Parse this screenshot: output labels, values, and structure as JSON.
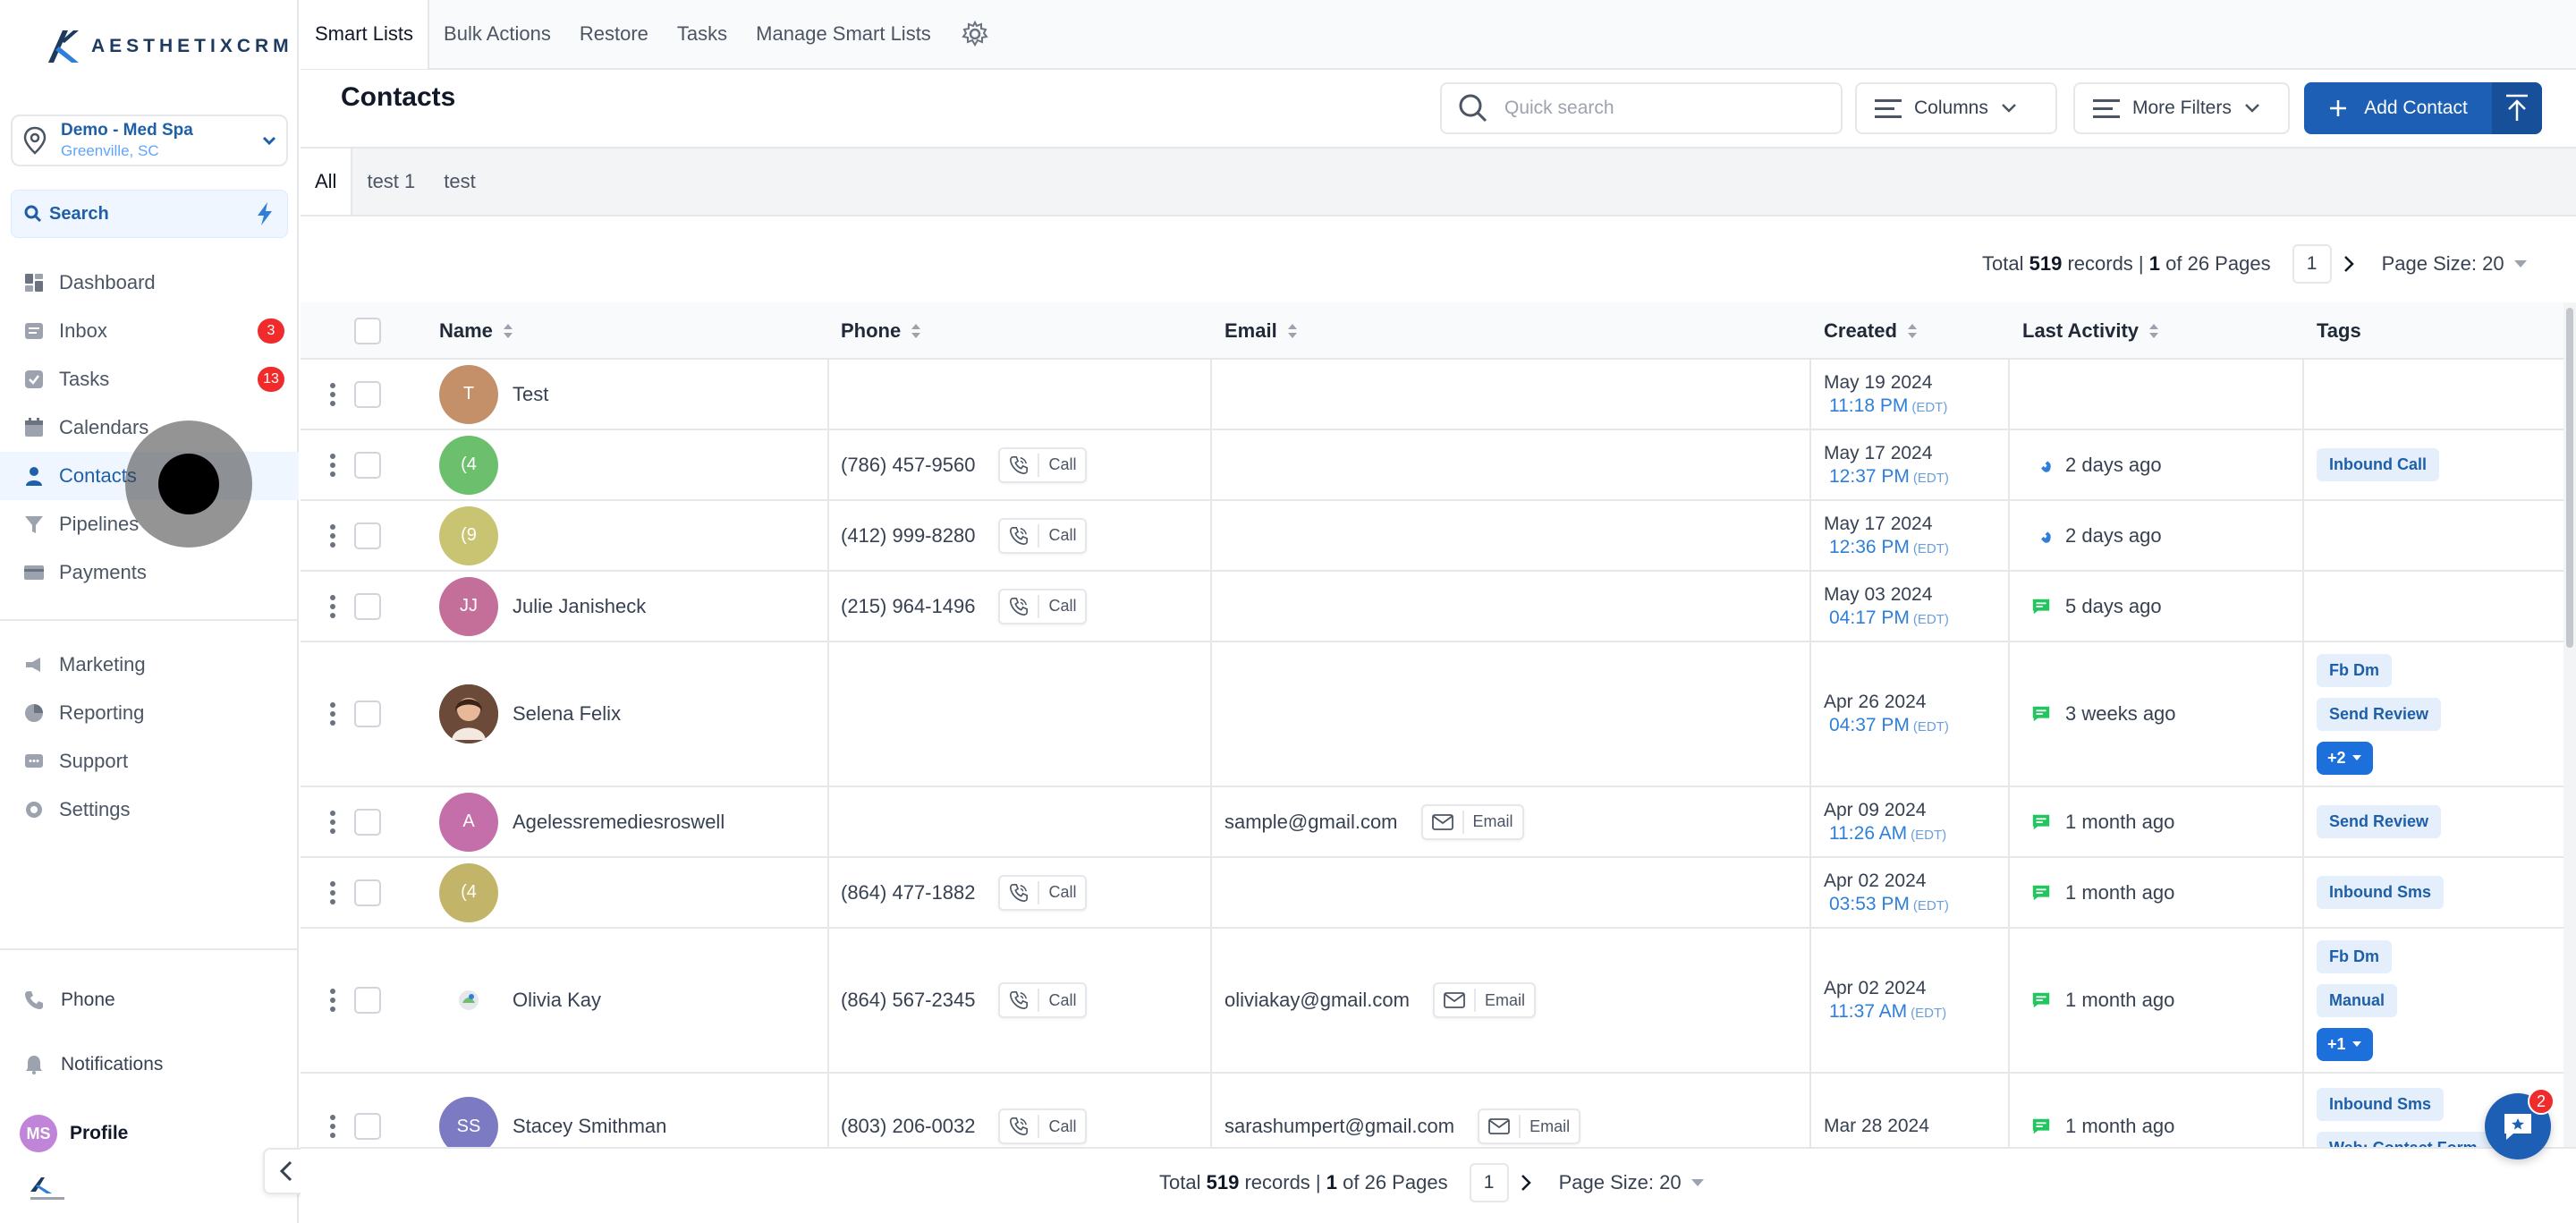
{
  "brand": {
    "logo_text": "AESTHETIXCRM"
  },
  "location": {
    "name": "Demo - Med Spa",
    "city": "Greenville, SC"
  },
  "sidebar": {
    "search_label": "Search",
    "items": [
      {
        "label": "Dashboard",
        "icon": "dashboard-icon"
      },
      {
        "label": "Inbox",
        "icon": "inbox-icon",
        "badge": "3"
      },
      {
        "label": "Tasks",
        "icon": "tasks-icon",
        "badge": "13"
      },
      {
        "label": "Calendars",
        "icon": "calendar-icon"
      },
      {
        "label": "Contacts",
        "icon": "user-icon",
        "active": true
      },
      {
        "label": "Pipelines",
        "icon": "filter-icon"
      },
      {
        "label": "Payments",
        "icon": "card-icon"
      }
    ],
    "items2": [
      {
        "label": "Marketing",
        "icon": "megaphone-icon"
      },
      {
        "label": "Reporting",
        "icon": "pie-chart-icon"
      },
      {
        "label": "Support",
        "icon": "chat-icon"
      },
      {
        "label": "Settings",
        "icon": "gear-icon"
      }
    ],
    "bottom": {
      "phone": "Phone",
      "notifications": "Notifications",
      "profile": "Profile",
      "profile_initials": "MS"
    }
  },
  "top_tabs": [
    "Smart Lists",
    "Bulk Actions",
    "Restore",
    "Tasks",
    "Manage Smart Lists"
  ],
  "header": {
    "title": "Contacts",
    "search_placeholder": "Quick search",
    "columns_label": "Columns",
    "filters_label": "More Filters",
    "add_label": "Add Contact"
  },
  "list_tabs": [
    "All",
    "test 1",
    "test"
  ],
  "pagination": {
    "total_prefix": "Total",
    "total": "519",
    "records_label": "records |",
    "page": "1",
    "of_label": "of 26 Pages",
    "current_page": "1",
    "page_size": "Page Size: 20"
  },
  "table": {
    "columns": [
      "Name",
      "Phone",
      "Email",
      "Created",
      "Last Activity",
      "Tags"
    ],
    "call_label": "Call",
    "email_label": "Email",
    "rows": [
      {
        "initials": "T",
        "avatar_color": "#c4906a",
        "name": "Test",
        "phone": "",
        "email": "",
        "date": "May 19 2024",
        "time": "11:18 PM",
        "tz": "(EDT)",
        "activity": "",
        "activity_icon": "",
        "tags": []
      },
      {
        "initials": "(4",
        "avatar_color": "#6cbf6c",
        "name": "",
        "phone": "(786) 457-9560",
        "email": "",
        "date": "May 17 2024",
        "time": "12:37 PM",
        "tz": "(EDT)",
        "activity": "2 days ago",
        "activity_icon": "phone-icon",
        "tags": [
          "Inbound Call"
        ]
      },
      {
        "initials": "(9",
        "avatar_color": "#c9c471",
        "name": "",
        "phone": "(412) 999-8280",
        "email": "",
        "date": "May 17 2024",
        "time": "12:36 PM",
        "tz": "(EDT)",
        "activity": "2 days ago",
        "activity_icon": "phone-icon",
        "tags": []
      },
      {
        "initials": "JJ",
        "avatar_color": "#c46f9a",
        "name": "Julie Janisheck",
        "phone": "(215) 964-1496",
        "email": "",
        "date": "May 03 2024",
        "time": "04:17 PM",
        "tz": "(EDT)",
        "activity": "5 days ago",
        "activity_icon": "message-icon",
        "tags": []
      },
      {
        "initials": "",
        "avatar_color": "#6b4a3a",
        "photo": true,
        "name": "Selena Felix",
        "phone": "",
        "email": "",
        "date": "Apr 26 2024",
        "time": "04:37 PM",
        "tz": "(EDT)",
        "activity": "3 weeks ago",
        "activity_icon": "message-icon",
        "tags": [
          "Fb Dm",
          "Send Review"
        ],
        "more": "+2"
      },
      {
        "initials": "A",
        "avatar_color": "#c46fa9",
        "name": "Agelessremediesroswell",
        "phone": "",
        "email": "sample@gmail.com",
        "date": "Apr 09 2024",
        "time": "11:26 AM",
        "tz": "(EDT)",
        "activity": "1 month ago",
        "activity_icon": "message-icon",
        "tags": [
          "Send Review"
        ]
      },
      {
        "initials": "(4",
        "avatar_color": "#c2b56a",
        "name": "",
        "phone": "(864) 477-1882",
        "email": "",
        "date": "Apr 02 2024",
        "time": "03:53 PM",
        "tz": "(EDT)",
        "activity": "1 month ago",
        "activity_icon": "message-icon",
        "tags": [
          "Inbound Sms"
        ]
      },
      {
        "initials": "",
        "avatar_color": "#ffffff",
        "small_logo": true,
        "name": "Olivia Kay",
        "phone": "(864) 567-2345",
        "email": "oliviakay@gmail.com",
        "date": "Apr 02 2024",
        "time": "11:37 AM",
        "tz": "(EDT)",
        "activity": "1 month ago",
        "activity_icon": "message-icon",
        "tags": [
          "Fb Dm",
          "Manual"
        ],
        "more": "+1"
      },
      {
        "initials": "SS",
        "avatar_color": "#7d7ac4",
        "name": "Stacey Smithman",
        "phone": "(803) 206-0032",
        "email": "sarashumpert@gmail.com",
        "date": "Mar 28 2024",
        "time": "",
        "tz": "",
        "activity": "1 month ago",
        "activity_icon": "message-icon",
        "tags": [
          "Inbound Sms",
          "Web: Contact Form"
        ]
      }
    ]
  },
  "chat_widget": {
    "badge": "2"
  },
  "colors": {
    "primary": "#1d5fb4",
    "badge_red": "#ef2b2b",
    "link_blue": "#2f7fd8"
  }
}
